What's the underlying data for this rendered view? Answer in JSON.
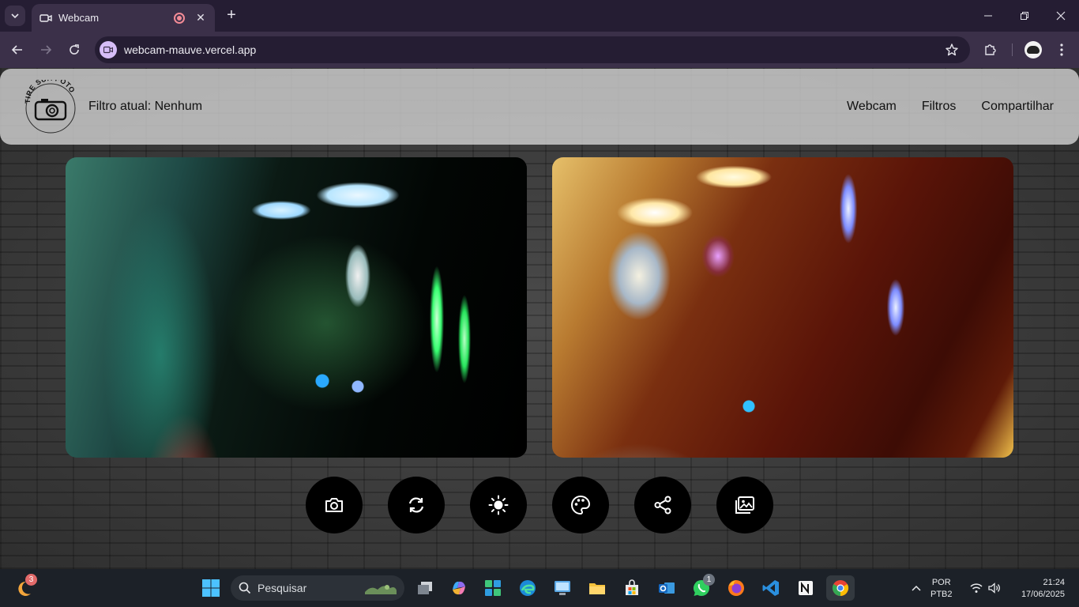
{
  "browser": {
    "tab_title": "Webcam",
    "tab_close": "✕",
    "new_tab": "+",
    "url": "webcam-mauve.vercel.app"
  },
  "header": {
    "logo_text": "TIRE SUA FOTO",
    "filter_label": "Filtro atual: Nenhum",
    "nav": [
      "Webcam",
      "Filtros",
      "Compartilhar"
    ]
  },
  "controls": [
    {
      "name": "camera-icon"
    },
    {
      "name": "refresh-icon"
    },
    {
      "name": "brightness-icon"
    },
    {
      "name": "palette-icon"
    },
    {
      "name": "share-icon"
    },
    {
      "name": "gallery-icon"
    }
  ],
  "taskbar": {
    "search_placeholder": "Pesquisar",
    "weather_badge": "3",
    "whatsapp_badge": "1",
    "lang_line1": "POR",
    "lang_line2": "PTB2",
    "time": "21:24",
    "date": "17/06/2025"
  },
  "colors": {
    "browser_frame": "#251d33",
    "toolbar": "#3b3049",
    "header_bg": "#d7d7d7",
    "button_bg": "#000000"
  }
}
